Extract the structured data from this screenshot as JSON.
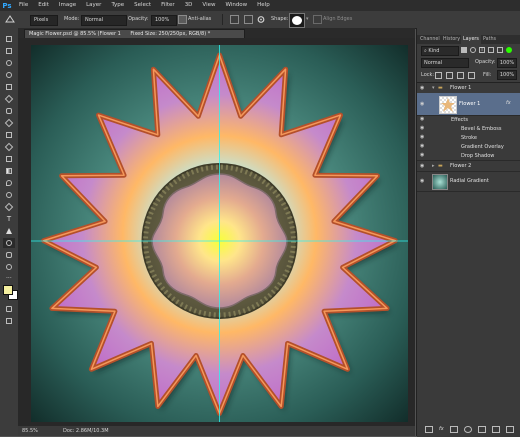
{
  "app": {
    "logo": "Ps"
  },
  "menu": [
    "File",
    "Edit",
    "Image",
    "Layer",
    "Type",
    "Select",
    "Filter",
    "3D",
    "View",
    "Window",
    "Help"
  ],
  "options": {
    "brush_preset": "Pixels",
    "mode_label": "Mode:",
    "mode_value": "Normal",
    "opacity_label": "Opacity:",
    "opacity_value": "100%",
    "antialias_label": "Anti-alias",
    "shape_label": "Shape:",
    "align_label": "Align Edges"
  },
  "document": {
    "tab_title": "Magic Flower.psd @ 85.5% (Flower 1",
    "fixed_size": "Fixed Size: 250/250px, RGB/8) *",
    "zoom": "85.5%",
    "doc_info": "Doc: 2.86M/10.3M"
  },
  "panel": {
    "tabs": [
      "Channel",
      "History",
      "Layers",
      "Paths"
    ],
    "active_tab": "Layers",
    "filter_kind": "Kind",
    "blend_mode": "Normal",
    "opacity_label": "Opacity:",
    "opacity_value": "100%",
    "lock_label": "Lock:",
    "fill_label": "Fill:",
    "fill_value": "100%",
    "fx_label": "fx",
    "layers": {
      "group1": "Flower 1",
      "layer1": "Flower 1",
      "effects_label": "Effects",
      "effects": [
        "Bevel & Emboss",
        "Stroke",
        "Gradient Overlay",
        "Drop Shadow"
      ],
      "group2": "Flower 2",
      "background": "Radial Gradient"
    }
  },
  "colors": {
    "foreground": "#f5f0a0",
    "background": "#ffffff",
    "guide": "#2ff2ee",
    "accent": "#31a8ff"
  }
}
